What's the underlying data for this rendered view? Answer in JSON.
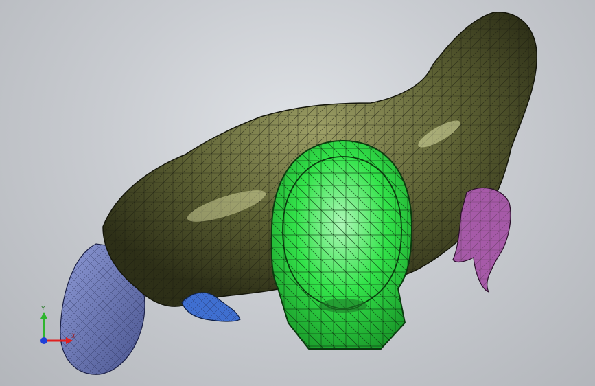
{
  "viewport": {
    "background_top": "#dfe2e6",
    "background_bottom": "#b3b6bb"
  },
  "model": {
    "parts": [
      {
        "name": "torso-garment",
        "color": "#5c6033"
      },
      {
        "name": "helmet",
        "color": "#33e34a"
      },
      {
        "name": "left-leg",
        "color": "#6e7bbd"
      },
      {
        "name": "left-hand",
        "color": "#3f6fd0"
      },
      {
        "name": "right-hand",
        "color": "#a65aa8"
      }
    ]
  },
  "triad": {
    "y_label": "Y",
    "x_label": "X",
    "x_color": "#e02020",
    "y_color": "#2fb52f",
    "z_color": "#1f3fd8"
  }
}
